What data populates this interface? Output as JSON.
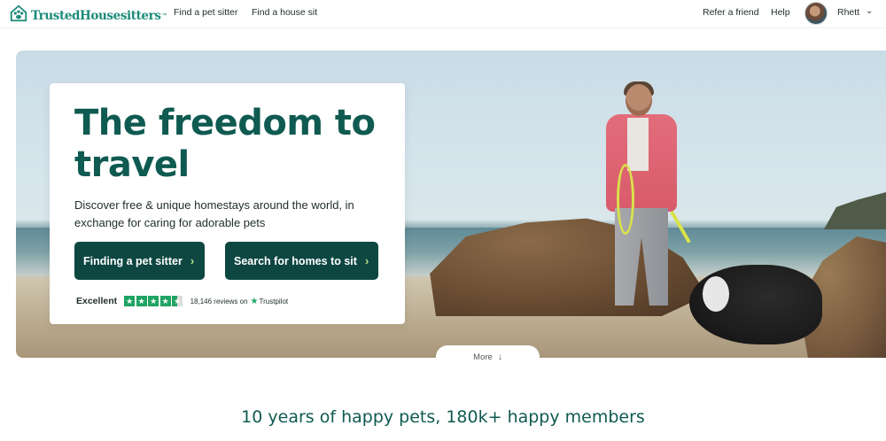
{
  "brand": {
    "name": "TrustedHousesitters",
    "tm": "™",
    "color": "#1b8a7a"
  },
  "nav": {
    "links": [
      "Find a pet sitter",
      "Find a house sit"
    ],
    "right_links": [
      "Refer a friend",
      "Help"
    ],
    "user": {
      "name": "Rhett",
      "avatar_icon": "user-avatar-photo"
    }
  },
  "hero": {
    "headline": "The freedom to travel",
    "subtext": "Discover free & unique homestays around the world, in exchange for caring for adorable pets",
    "cta_pet_sitter": "Finding a pet sitter",
    "cta_homes": "Search for homes to sit",
    "cta_color": "#0e4742",
    "trustpilot": {
      "rating_word": "Excellent",
      "stars": 4.5,
      "reviews": "18,146 reviews on",
      "brand": "Trustpilot"
    }
  },
  "more": {
    "label": "More"
  },
  "tagline": "10 years of happy pets, 180k+ happy members"
}
